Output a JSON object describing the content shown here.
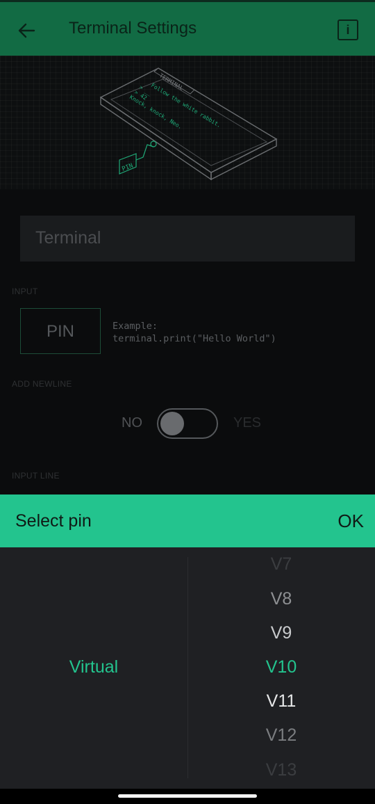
{
  "header": {
    "title": "Terminal Settings",
    "info_label": "i"
  },
  "illustration": {
    "device_label": "TERMINAL",
    "screen_lines": [
      "Follow the white rabbit.",
      "> __",
      "> 42",
      "Knock, knock, Neo."
    ],
    "pin_tag": "PIN"
  },
  "name_field": {
    "value": "Terminal"
  },
  "input_section": {
    "label": "INPUT",
    "pin_button": "PIN",
    "example_title": "Example:",
    "example_code": "terminal.print(\"Hello World\")"
  },
  "newline_section": {
    "label": "ADD NEWLINE",
    "off_label": "NO",
    "on_label": "YES",
    "enabled": false
  },
  "input_line_section": {
    "label": "INPUT LINE"
  },
  "pin_picker": {
    "title": "Select pin",
    "ok_label": "OK",
    "pin_type": "Virtual",
    "pins": [
      "V7",
      "V8",
      "V9",
      "V10",
      "V11",
      "V12",
      "V13"
    ],
    "selected_pin": "V10"
  },
  "colors": {
    "header": "#126b44",
    "accent": "#23c48e",
    "background": "#0b0c0d",
    "picker_body": "#1f2023"
  }
}
